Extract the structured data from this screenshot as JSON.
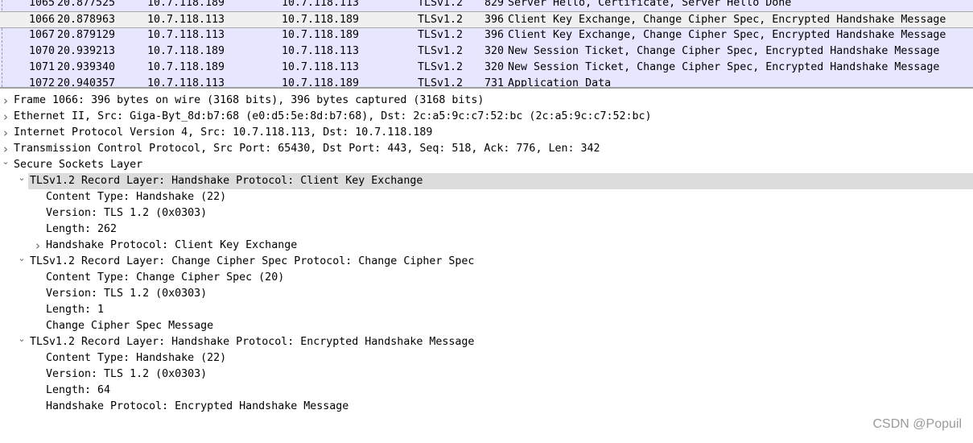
{
  "packets": [
    {
      "no": "1065",
      "time": "20.877525",
      "src": "10.7.118.189",
      "dst": "10.7.118.113",
      "proto": "TLSv1.2",
      "len": "829",
      "info": "Server Hello, Certificate, Server Hello Done"
    },
    {
      "no": "1066",
      "time": "20.878963",
      "src": "10.7.118.113",
      "dst": "10.7.118.189",
      "proto": "TLSv1.2",
      "len": "396",
      "info": "Client Key Exchange, Change Cipher Spec, Encrypted Handshake Message",
      "selected": true
    },
    {
      "no": "1067",
      "time": "20.879129",
      "src": "10.7.118.113",
      "dst": "10.7.118.189",
      "proto": "TLSv1.2",
      "len": "396",
      "info": "Client Key Exchange, Change Cipher Spec, Encrypted Handshake Message"
    },
    {
      "no": "1070",
      "time": "20.939213",
      "src": "10.7.118.189",
      "dst": "10.7.118.113",
      "proto": "TLSv1.2",
      "len": "320",
      "info": "New Session Ticket, Change Cipher Spec, Encrypted Handshake Message"
    },
    {
      "no": "1071",
      "time": "20.939340",
      "src": "10.7.118.189",
      "dst": "10.7.118.113",
      "proto": "TLSv1.2",
      "len": "320",
      "info": "New Session Ticket, Change Cipher Spec, Encrypted Handshake Message"
    },
    {
      "no": "1072",
      "time": "20.940357",
      "src": "10.7.118.113",
      "dst": "10.7.118.189",
      "proto": "TLSv1.2",
      "len": "731",
      "info": "Application Data"
    }
  ],
  "details": [
    {
      "level": 0,
      "toggle": "collapsed",
      "text": "Frame 1066: 396 bytes on wire (3168 bits), 396 bytes captured (3168 bits)"
    },
    {
      "level": 0,
      "toggle": "collapsed",
      "text": "Ethernet II, Src: Giga-Byt_8d:b7:68 (e0:d5:5e:8d:b7:68), Dst: 2c:a5:9c:c7:52:bc (2c:a5:9c:c7:52:bc)"
    },
    {
      "level": 0,
      "toggle": "collapsed",
      "text": "Internet Protocol Version 4, Src: 10.7.118.113, Dst: 10.7.118.189"
    },
    {
      "level": 0,
      "toggle": "collapsed",
      "text": "Transmission Control Protocol, Src Port: 65430, Dst Port: 443, Seq: 518, Ack: 776, Len: 342"
    },
    {
      "level": 0,
      "toggle": "expanded",
      "text": "Secure Sockets Layer"
    },
    {
      "level": 1,
      "toggle": "expanded",
      "text": "TLSv1.2 Record Layer: Handshake Protocol: Client Key Exchange",
      "selected": true
    },
    {
      "level": 2,
      "toggle": "none",
      "text": "Content Type: Handshake (22)"
    },
    {
      "level": 2,
      "toggle": "none",
      "text": "Version: TLS 1.2 (0x0303)"
    },
    {
      "level": 2,
      "toggle": "none",
      "text": "Length: 262"
    },
    {
      "level": 2,
      "toggle": "collapsed",
      "text": "Handshake Protocol: Client Key Exchange"
    },
    {
      "level": 1,
      "toggle": "expanded",
      "text": "TLSv1.2 Record Layer: Change Cipher Spec Protocol: Change Cipher Spec"
    },
    {
      "level": 2,
      "toggle": "none",
      "text": "Content Type: Change Cipher Spec (20)"
    },
    {
      "level": 2,
      "toggle": "none",
      "text": "Version: TLS 1.2 (0x0303)"
    },
    {
      "level": 2,
      "toggle": "none",
      "text": "Length: 1"
    },
    {
      "level": 2,
      "toggle": "none",
      "text": "Change Cipher Spec Message"
    },
    {
      "level": 1,
      "toggle": "expanded",
      "text": "TLSv1.2 Record Layer: Handshake Protocol: Encrypted Handshake Message"
    },
    {
      "level": 2,
      "toggle": "none",
      "text": "Content Type: Handshake (22)"
    },
    {
      "level": 2,
      "toggle": "none",
      "text": "Version: TLS 1.2 (0x0303)"
    },
    {
      "level": 2,
      "toggle": "none",
      "text": "Length: 64"
    },
    {
      "level": 2,
      "toggle": "none",
      "text": "Handshake Protocol: Encrypted Handshake Message"
    }
  ],
  "watermark": "CSDN @Popuil",
  "colors": {
    "packet_bg": "#e7e6ff",
    "selected_packet": "#f0f0f0",
    "selected_detail": "#dcdcdc"
  }
}
